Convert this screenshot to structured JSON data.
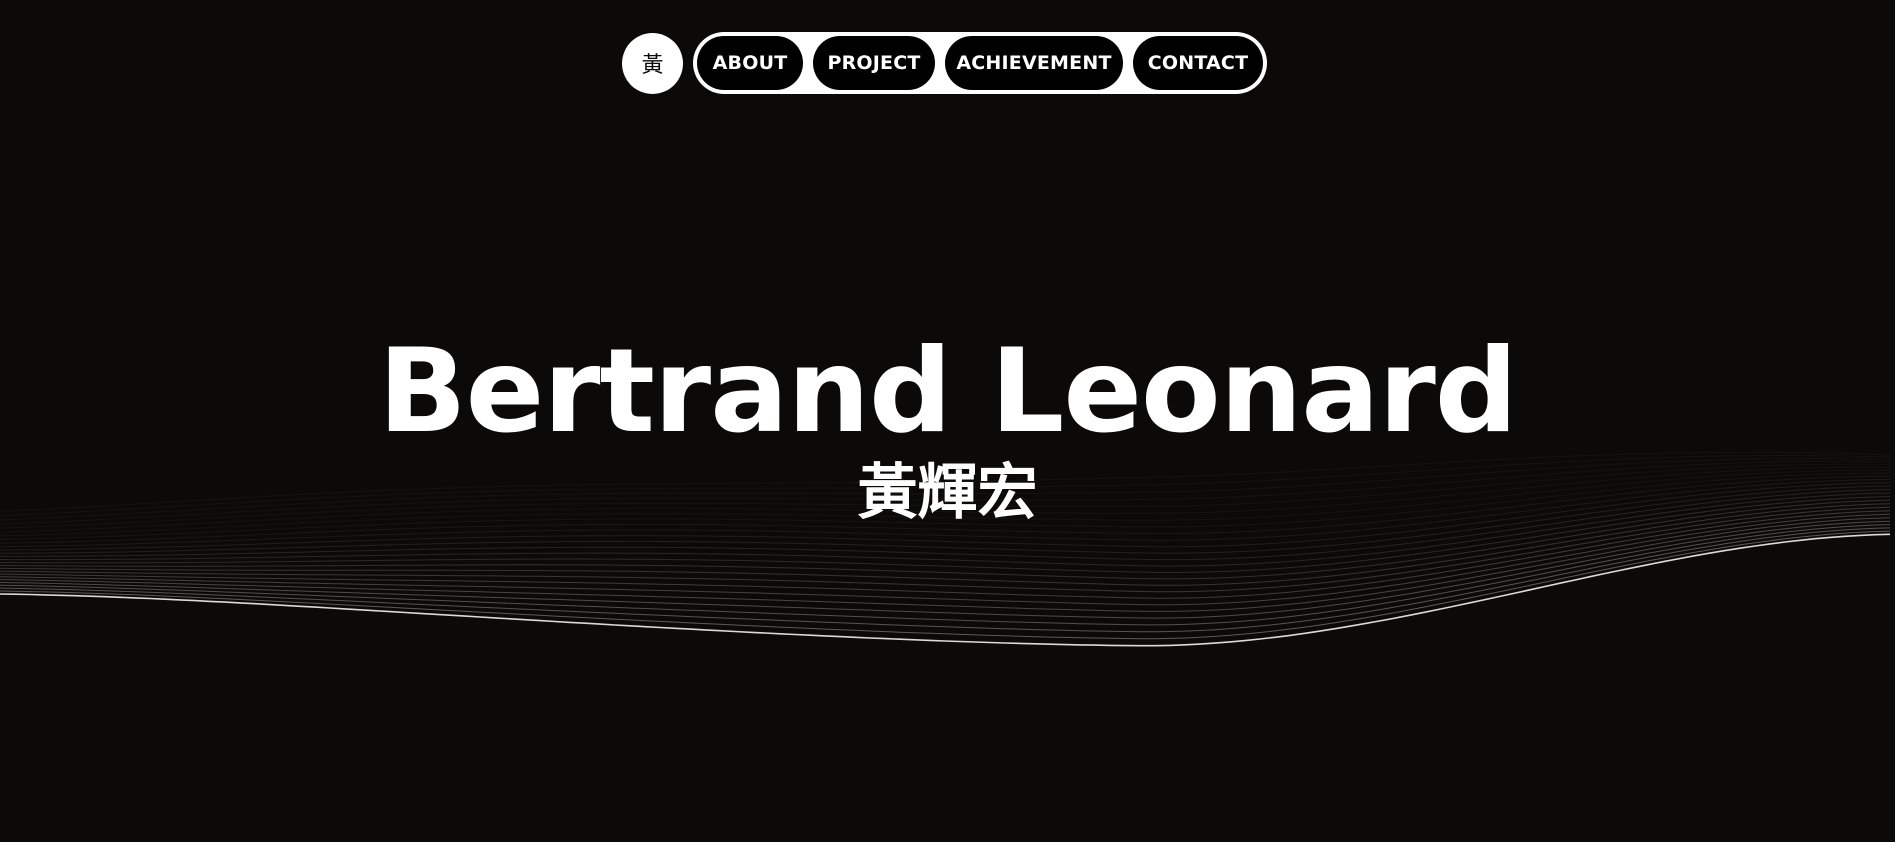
{
  "nav": {
    "logo_label": "黃",
    "items": [
      {
        "label": "ABOUT"
      },
      {
        "label": "PROJECT"
      },
      {
        "label": "ACHIEVEMENT"
      },
      {
        "label": "CONTACT"
      }
    ]
  },
  "hero": {
    "name": "Bertrand Leonard",
    "subname": "黃輝宏"
  },
  "colors": {
    "background": "#0b0a09",
    "foreground": "#ffffff",
    "nav_item_bg": "#000000"
  }
}
